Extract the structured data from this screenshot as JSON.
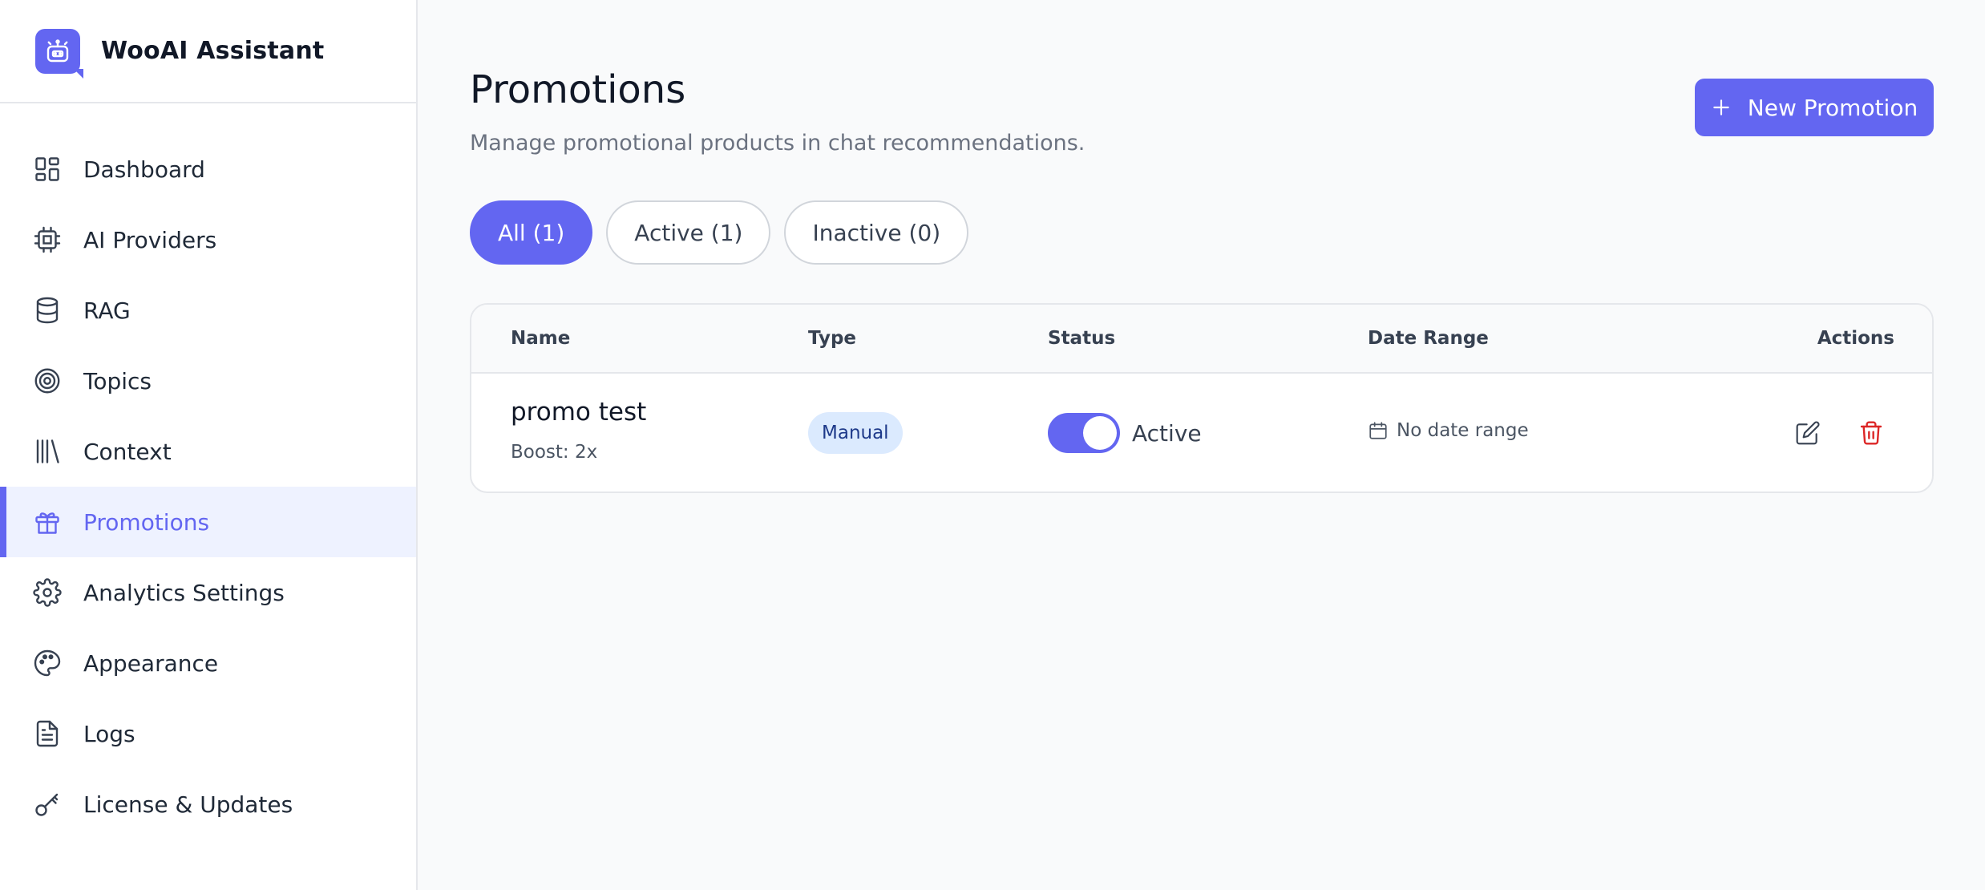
{
  "app": {
    "title": "WooAI Assistant"
  },
  "sidebar": {
    "items": [
      {
        "label": "Dashboard",
        "icon": "dashboard-icon"
      },
      {
        "label": "AI Providers",
        "icon": "chip-icon"
      },
      {
        "label": "RAG",
        "icon": "database-icon"
      },
      {
        "label": "Topics",
        "icon": "target-icon"
      },
      {
        "label": "Context",
        "icon": "library-icon"
      },
      {
        "label": "Promotions",
        "icon": "gift-icon",
        "active": true
      },
      {
        "label": "Analytics Settings",
        "icon": "gear-icon"
      },
      {
        "label": "Appearance",
        "icon": "palette-icon"
      },
      {
        "label": "Logs",
        "icon": "document-icon"
      },
      {
        "label": "License & Updates",
        "icon": "key-icon"
      }
    ]
  },
  "header": {
    "title": "Promotions",
    "subtitle": "Manage promotional products in chat recommendations.",
    "new_button_label": "New Promotion"
  },
  "filters": {
    "all": "All (1)",
    "active": "Active (1)",
    "inactive": "Inactive (0)",
    "selected": "all"
  },
  "table": {
    "columns": {
      "name": "Name",
      "type": "Type",
      "status": "Status",
      "date_range": "Date Range",
      "actions": "Actions"
    },
    "rows": [
      {
        "name": "promo test",
        "boost": "Boost: 2x",
        "type": "Manual",
        "status": "Active",
        "status_on": true,
        "date_range": "No date range"
      }
    ]
  },
  "colors": {
    "accent": "#6366f1",
    "accent_light": "#eef2ff",
    "badge_bg": "#dbeafe",
    "badge_text": "#1e3a8a",
    "danger": "#dc2626"
  }
}
